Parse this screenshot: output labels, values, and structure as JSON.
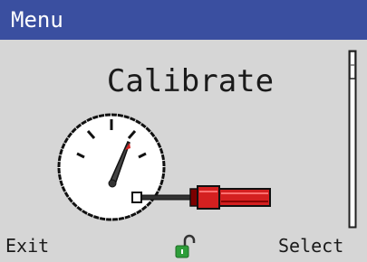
{
  "header": {
    "title": "Menu",
    "background": "#3a4fa0"
  },
  "main": {
    "heading": "Calibrate",
    "illustration_icon": "gauge-with-screwdriver-icon"
  },
  "status": {
    "lock_icon": "unlocked-padlock-icon",
    "lock_color": "#2e9e3a"
  },
  "softkeys": {
    "left_label": "Exit",
    "right_label": "Select"
  },
  "scrollbar": {
    "position_fraction": 0.0
  },
  "colors": {
    "screen_background": "#d6d6d6",
    "needle_accent": "#d42020",
    "screwdriver_handle": "#d42020"
  }
}
